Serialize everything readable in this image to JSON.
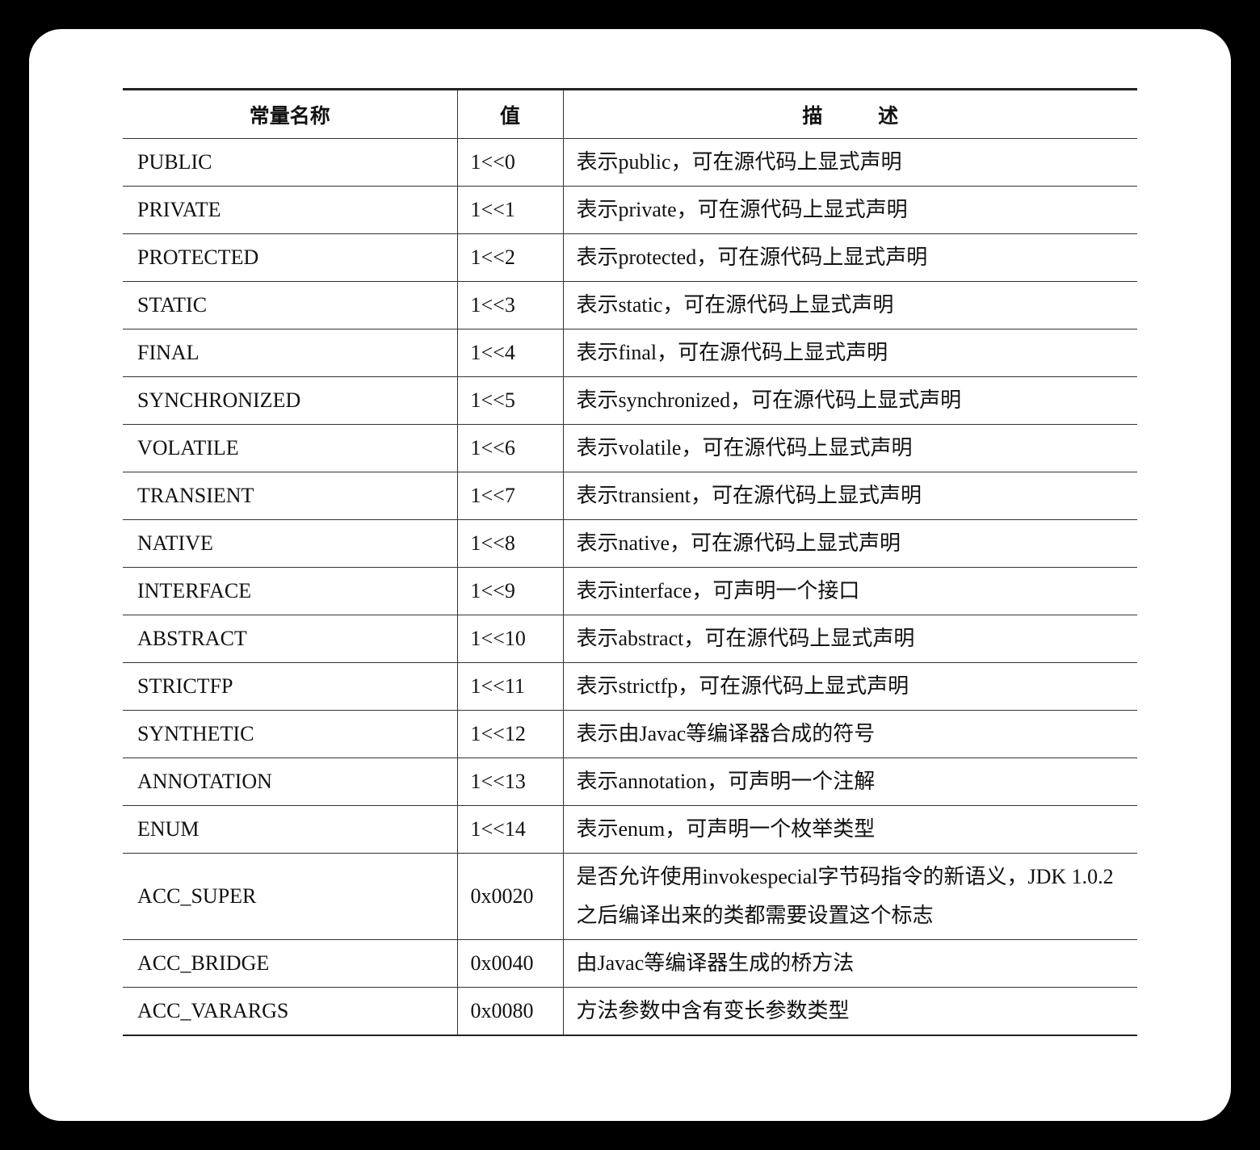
{
  "table": {
    "headers": {
      "name": "常量名称",
      "value": "值",
      "desc": "描 述"
    },
    "rows": [
      {
        "name": "PUBLIC",
        "value": "1<<0",
        "desc": "表示public，可在源代码上显式声明"
      },
      {
        "name": "PRIVATE",
        "value": "1<<1",
        "desc": "表示private，可在源代码上显式声明"
      },
      {
        "name": "PROTECTED",
        "value": "1<<2",
        "desc": "表示protected，可在源代码上显式声明"
      },
      {
        "name": "STATIC",
        "value": "1<<3",
        "desc": "表示static，可在源代码上显式声明"
      },
      {
        "name": "FINAL",
        "value": "1<<4",
        "desc": "表示final，可在源代码上显式声明"
      },
      {
        "name": "SYNCHRONIZED",
        "value": "1<<5",
        "desc": "表示synchronized，可在源代码上显式声明"
      },
      {
        "name": "VOLATILE",
        "value": "1<<6",
        "desc": "表示volatile，可在源代码上显式声明"
      },
      {
        "name": "TRANSIENT",
        "value": "1<<7",
        "desc": "表示transient，可在源代码上显式声明"
      },
      {
        "name": "NATIVE",
        "value": "1<<8",
        "desc": "表示native，可在源代码上显式声明"
      },
      {
        "name": "INTERFACE",
        "value": "1<<9",
        "desc": "表示interface，可声明一个接口"
      },
      {
        "name": "ABSTRACT",
        "value": "1<<10",
        "desc": "表示abstract，可在源代码上显式声明"
      },
      {
        "name": "STRICTFP",
        "value": "1<<11",
        "desc": "表示strictfp，可在源代码上显式声明"
      },
      {
        "name": "SYNTHETIC",
        "value": "1<<12",
        "desc": "表示由Javac等编译器合成的符号"
      },
      {
        "name": "ANNOTATION",
        "value": "1<<13",
        "desc": "表示annotation，可声明一个注解"
      },
      {
        "name": "ENUM",
        "value": "1<<14",
        "desc": "表示enum，可声明一个枚举类型"
      },
      {
        "name": "ACC_SUPER",
        "value": "0x0020",
        "desc": "是否允许使用invokespecial字节码指令的新语义，JDK 1.0.2之后编译出来的类都需要设置这个标志"
      },
      {
        "name": "ACC_BRIDGE",
        "value": "0x0040",
        "desc": "由Javac等编译器生成的桥方法"
      },
      {
        "name": "ACC_VARARGS",
        "value": "0x0080",
        "desc": "方法参数中含有变长参数类型"
      }
    ]
  }
}
